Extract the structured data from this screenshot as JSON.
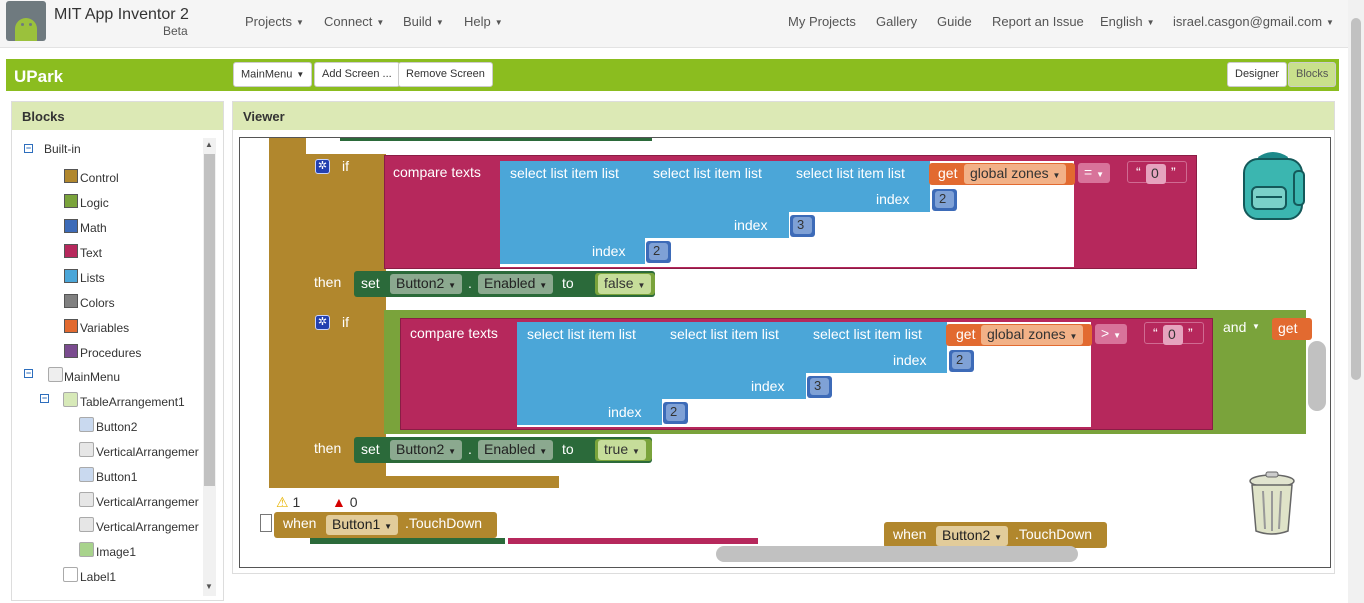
{
  "topbar": {
    "brand": "MIT App Inventor 2",
    "beta": "Beta",
    "menus": [
      "Projects",
      "Connect",
      "Build",
      "Help"
    ],
    "links": [
      "My Projects",
      "Gallery",
      "Guide",
      "Report an Issue"
    ],
    "language": "English",
    "account": "israel.casgon@gmail.com"
  },
  "project_bar": {
    "name": "UPark",
    "screen_selector": "MainMenu",
    "add_screen": "Add Screen ...",
    "remove_screen": "Remove Screen",
    "designer": "Designer",
    "blocks": "Blocks"
  },
  "blocks_panel": {
    "title": "Blocks",
    "builtin_label": "Built-in",
    "categories": [
      {
        "label": "Control",
        "color": "#b1872d"
      },
      {
        "label": "Logic",
        "color": "#7aa33b"
      },
      {
        "label": "Math",
        "color": "#3d6bb8"
      },
      {
        "label": "Text",
        "color": "#b6285c"
      },
      {
        "label": "Lists",
        "color": "#4ba6d8"
      },
      {
        "label": "Colors",
        "color": "#808080"
      },
      {
        "label": "Variables",
        "color": "#e26a30"
      },
      {
        "label": "Procedures",
        "color": "#7a4b8f"
      }
    ],
    "components": {
      "screen": "MainMenu",
      "arrangement": "TableArrangement1",
      "children": [
        "Button2",
        "VerticalArrangemer",
        "Button1",
        "VerticalArrangemer",
        "VerticalArrangemer",
        "Image1"
      ],
      "after": [
        "Label1"
      ]
    }
  },
  "viewer": {
    "title": "Viewer",
    "warnings": "1",
    "errors": "0",
    "if_label": "if",
    "then_label": "then",
    "compare_texts": "compare texts",
    "select_list_item": "select list item  list",
    "index_label": "index",
    "get_label": "get",
    "global_var": "global zones",
    "op_eq": "=",
    "op_gt": ">",
    "text_zero": "0",
    "idx2": "2",
    "idx3": "3",
    "set_label": "set",
    "component": "Button2",
    "property": "Enabled",
    "to_label": "to",
    "val_false": "false",
    "val_true": "true",
    "and_label": "and",
    "get_partial": "get",
    "when_label": "when",
    "event1_component": "Button1",
    "event2_component": "Button2",
    "event_name": ".TouchDown"
  }
}
